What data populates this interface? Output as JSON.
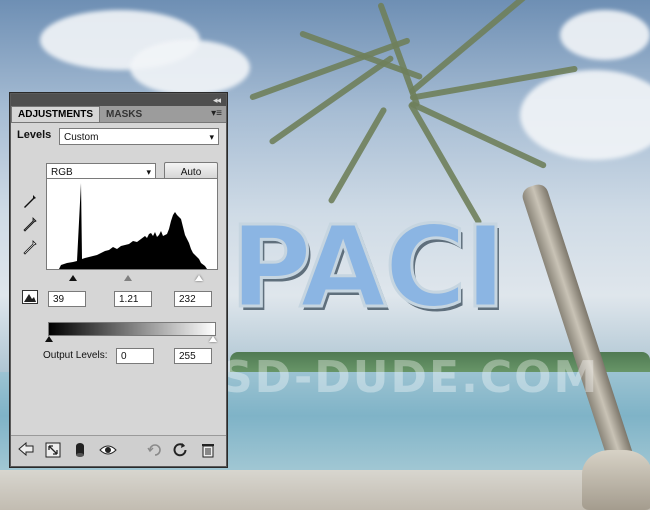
{
  "panel": {
    "collapse_glyph": "◂◂",
    "tabs": [
      {
        "label": "ADJUSTMENTS"
      },
      {
        "label": "MASKS"
      }
    ],
    "menu_glyph": "▾≡",
    "preset_label": "Levels",
    "preset_value": "Custom",
    "channel_value": "RGB",
    "auto_label": "Auto",
    "input_levels": {
      "black": "39",
      "gamma": "1.21",
      "white": "232"
    },
    "output_label": "Output Levels:",
    "output_levels": {
      "black": "0",
      "white": "255"
    },
    "caret": "▾"
  },
  "background": {
    "headline_text": "PACI",
    "watermark_text": "WWW.PSD-DUDE.COM"
  },
  "icons": {
    "eyedropper_black": "eyedropper-black-icon",
    "eyedropper_gray": "eyedropper-gray-icon",
    "eyedropper_white": "eyedropper-white-icon",
    "clipping_warning": "clipping-warning-icon",
    "back": "back-arrow-icon",
    "expand": "expand-view-icon",
    "clip_layer": "clip-to-layer-icon",
    "visibility": "eye-icon",
    "previous_state": "previous-state-icon",
    "reset": "reset-icon",
    "delete": "trash-icon"
  },
  "colors": {
    "panel_bg": "#d6d6d6",
    "panel_title": "#4f4f4f",
    "histogram": "#000000"
  }
}
